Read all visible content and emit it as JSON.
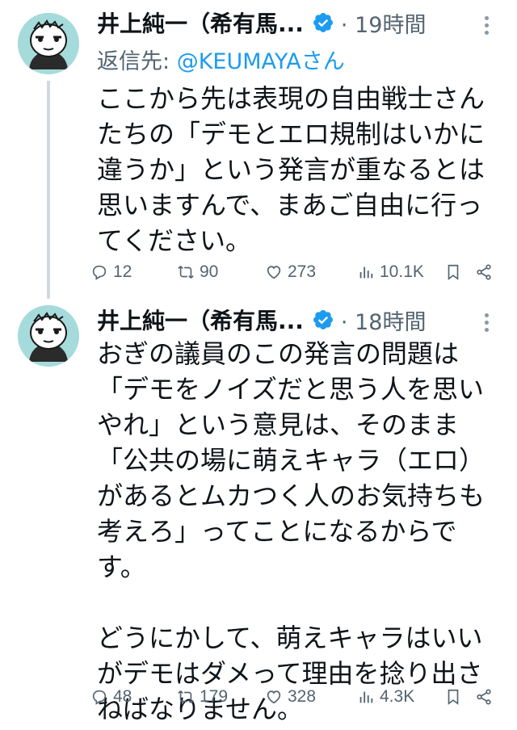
{
  "tweets": [
    {
      "author_name": "井上純一（希有馬...",
      "time": "· 19時間",
      "reply_prefix": "返信先: ",
      "reply_handle": "@KEUMAYAさん",
      "paragraphs": [
        "ここから先は表現の自由戦士さんたちの「デモとエロ規制はいかに違うか」という発言が重なるとは思いますんで、まあご自由に行ってください。"
      ],
      "stats": {
        "replies": "12",
        "retweets": "90",
        "likes": "273",
        "views": "10.1K"
      }
    },
    {
      "author_name": "井上純一（希有馬...",
      "time": "· 18時間",
      "paragraphs": [
        "おぎの議員のこの発言の問題は「デモをノイズだと思う人を思いやれ」という意見は、そのまま「公共の場に萌えキャラ（エロ）があるとムカつく人のお気持ちも考えろ」ってことになるからです。",
        "どうにかして、萌えキャラはいいがデモはダメって理由を捻り出さねばなりません。"
      ],
      "stats": {
        "replies": "48",
        "retweets": "179",
        "likes": "328",
        "views": "4.3K"
      }
    }
  ],
  "icons": {
    "reply": "reply-icon",
    "retweet": "retweet-icon",
    "like": "heart-icon",
    "views": "analytics-icon",
    "bookmark": "bookmark-icon",
    "share": "share-icon",
    "verified": "verified-badge-icon",
    "more": "more-options-icon"
  },
  "colors": {
    "text": "#0f1419",
    "secondary": "#536471",
    "link": "#1d9bf0",
    "verified": "#1d9bf0",
    "thread_line": "#cfd9de",
    "avatar_bg": "#a6dbdb"
  }
}
